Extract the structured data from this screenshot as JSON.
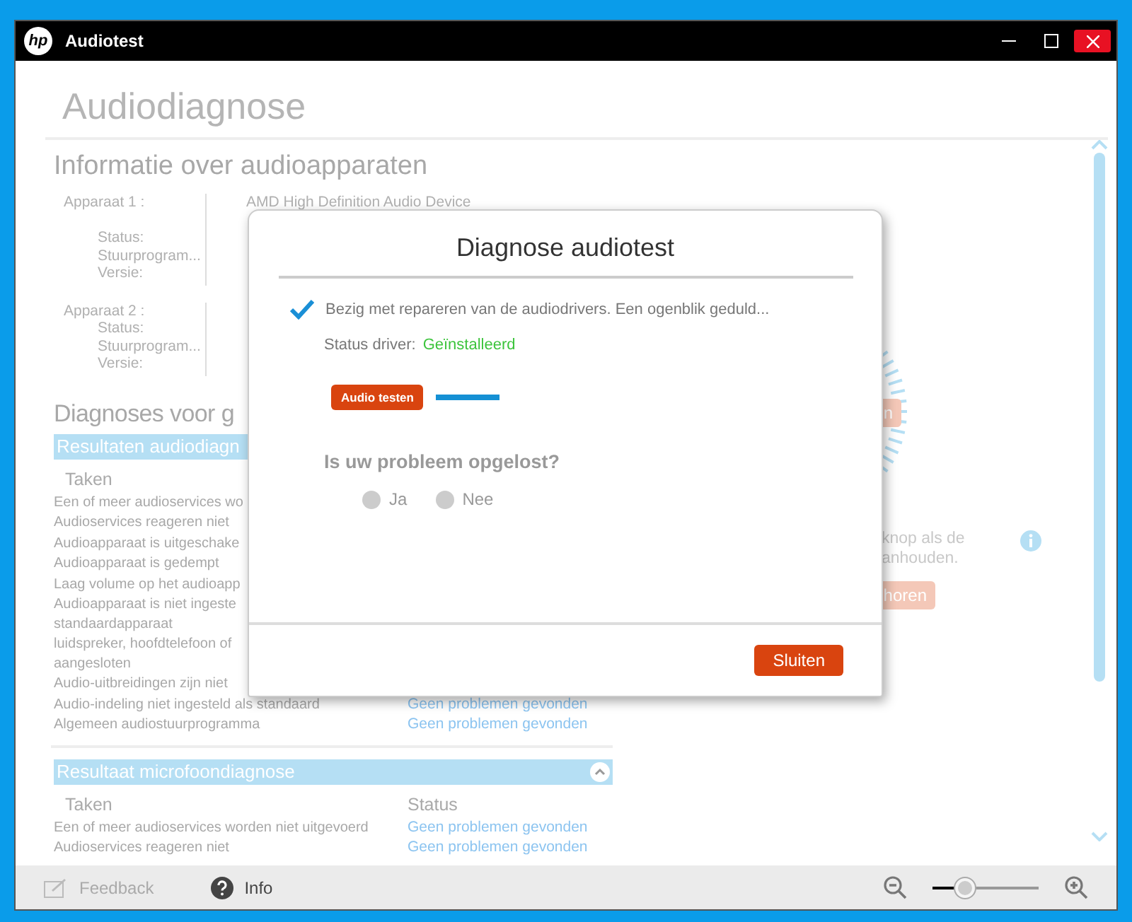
{
  "window": {
    "logo": "hp",
    "title": "Audiotest"
  },
  "page_title": "Audiodiagnose",
  "device_info": {
    "title": "Informatie over audioapparaten",
    "devices": [
      {
        "label": "Apparaat 1 :",
        "name": "AMD High Definition Audio Device",
        "fields": [
          "Status:",
          "Stuurprogram...",
          "Versie:"
        ]
      },
      {
        "label": "Apparaat 2 :",
        "fields": [
          "Status:",
          "Stuurprogram...",
          "Versie:"
        ]
      }
    ]
  },
  "diagnoses_title": "Diagnoses voor g",
  "audio_results": {
    "title": "Resultaten audiodiagn",
    "columns": [
      "Taken"
    ],
    "rows": [
      {
        "lines": [
          "Een of meer audioservices wo"
        ]
      },
      {
        "lines": [
          "Audioservices reageren niet"
        ]
      },
      {
        "lines": [
          "Audioapparaat is uitgeschake"
        ]
      },
      {
        "lines": [
          "Audioapparaat is gedempt"
        ]
      },
      {
        "lines": [
          "Laag volume op het audioapp"
        ]
      },
      {
        "lines": [
          "Audioapparaat is niet ingeste",
          "standaardapparaat"
        ]
      },
      {
        "lines": [
          "luidspreker, hoofdtelefoon of",
          "aangesloten"
        ]
      },
      {
        "lines": [
          "Audio-uitbreidingen zijn niet"
        ]
      },
      {
        "lines": [
          "Audio-indeling niet ingesteld als standaard"
        ],
        "status": "Geen problemen gevonden"
      },
      {
        "lines": [
          "Algemeen audiostuurprogramma"
        ],
        "status": "Geen problemen gevonden"
      }
    ]
  },
  "mic_results": {
    "title": "Resultaat microfoondiagnose",
    "expanded": true,
    "columns": [
      "Taken",
      "Status"
    ],
    "rows": [
      {
        "lines": [
          "Een of meer audioservices worden niet uitgevoerd"
        ],
        "status": "Geen problemen gevonden"
      },
      {
        "lines": [
          "Audioservices reageren niet"
        ],
        "status": "Geen problemen gevonden"
      }
    ]
  },
  "right_panel": {
    "button_1": "n",
    "instructions": [
      "knop als de",
      "anhouden."
    ],
    "button_2": "horen"
  },
  "dialog": {
    "title": "Diagnose audiotest",
    "message": "Bezig met repareren van de audiodrivers. Een ogenblik geduld...",
    "status_label": "Status driver:",
    "status_value": "Geïnstalleerd",
    "test_button": "Audio testen",
    "question": "Is uw probleem opgelost?",
    "radios": [
      {
        "label": "Ja",
        "selected": false
      },
      {
        "label": "Nee",
        "selected": false
      }
    ],
    "close_button": "Sluiten"
  },
  "footer": {
    "feedback": "Feedback",
    "info": "Info",
    "zoom": {
      "level": 0.3
    }
  }
}
